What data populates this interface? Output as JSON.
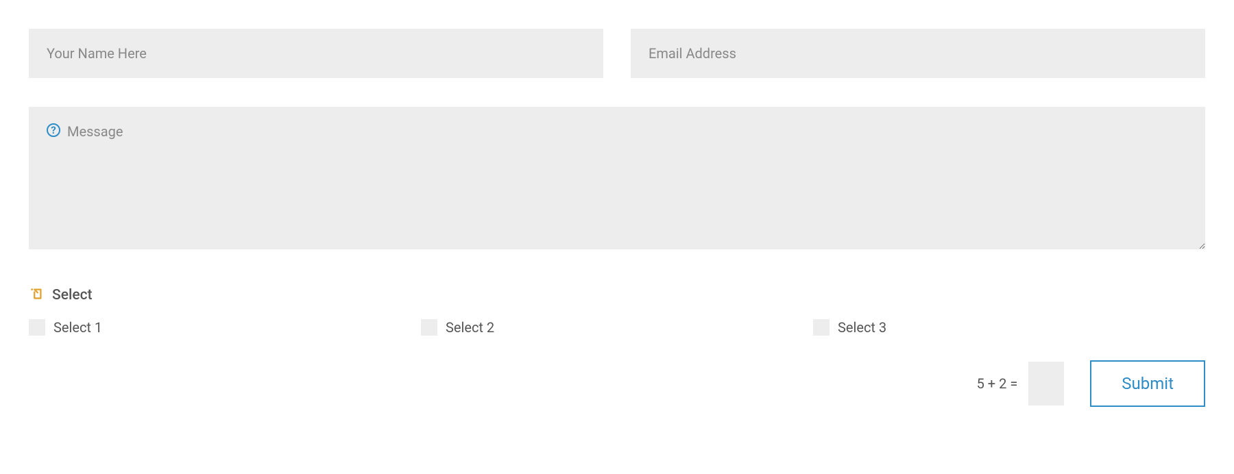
{
  "form": {
    "name": {
      "placeholder": "Your Name Here",
      "value": ""
    },
    "email": {
      "placeholder": "Email Address",
      "value": ""
    },
    "message": {
      "placeholder": "Message",
      "value": ""
    },
    "select_label": "Select",
    "checkboxes": [
      {
        "label": "Select 1"
      },
      {
        "label": "Select 2"
      },
      {
        "label": "Select 3"
      }
    ],
    "captcha": "5 + 2 =",
    "submit_label": "Submit"
  }
}
